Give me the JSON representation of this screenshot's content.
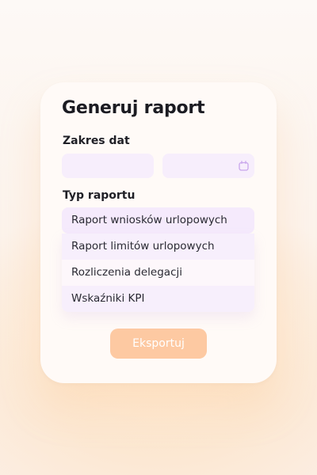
{
  "dialog": {
    "title": "Generuj raport"
  },
  "date_range": {
    "label": "Zakres dat",
    "from_value": "",
    "to_value": "",
    "icon": "calendar-icon"
  },
  "report_type": {
    "label": "Typ raportu",
    "selected": "Raport wniosków urlopowych",
    "options": [
      "Raport limitów urlopowych",
      "Rozliczenia delegacji",
      "Wskaźniki KPI"
    ]
  },
  "actions": {
    "export_label": "Eksportuj"
  },
  "colors": {
    "accent": "#fdc9a2",
    "input_bg": "#f7eefc",
    "icon": "#c9a6ec"
  }
}
